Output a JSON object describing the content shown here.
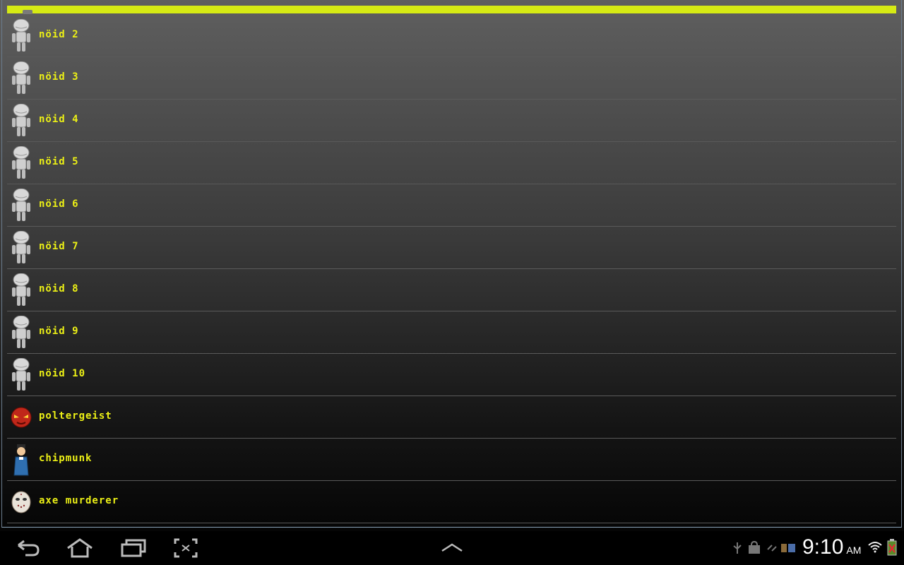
{
  "list": {
    "items": [
      {
        "label": "nöid 2",
        "avatar": "robot-icon"
      },
      {
        "label": "nöid 3",
        "avatar": "robot-icon"
      },
      {
        "label": "nöid 4",
        "avatar": "robot-icon"
      },
      {
        "label": "nöid 5",
        "avatar": "robot-icon"
      },
      {
        "label": "nöid 6",
        "avatar": "robot-icon"
      },
      {
        "label": "nöid 7",
        "avatar": "robot-icon"
      },
      {
        "label": "nöid 8",
        "avatar": "robot-icon"
      },
      {
        "label": "nöid 9",
        "avatar": "robot-icon"
      },
      {
        "label": "nöid 10",
        "avatar": "robot-icon"
      },
      {
        "label": "poltergeist",
        "avatar": "devil-face-icon"
      },
      {
        "label": "chipmunk",
        "avatar": "character-icon"
      },
      {
        "label": "axe murderer",
        "avatar": "hockey-mask-icon"
      }
    ]
  },
  "colors": {
    "accent": "#d6ea14",
    "label": "#ecf016"
  },
  "status_bar": {
    "time": "9:10",
    "ampm": "AM"
  },
  "navbar": {
    "buttons": [
      "back-icon",
      "home-icon",
      "recent-apps-icon",
      "screenshot-icon",
      "up-chevron-icon"
    ]
  }
}
